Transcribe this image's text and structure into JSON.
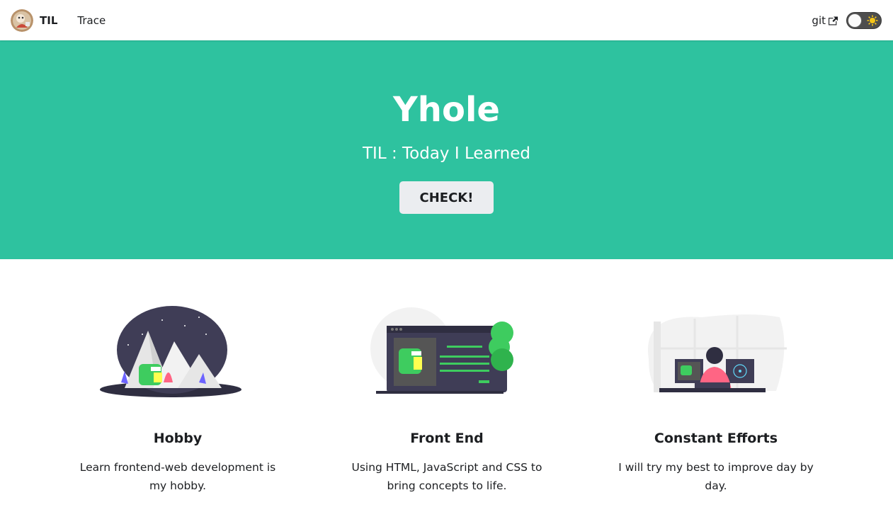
{
  "navbar": {
    "brand_title": "TIL",
    "links": [
      {
        "label": "Trace"
      }
    ],
    "git_label": "git",
    "theme_toggle": {
      "mode": "light",
      "icons": [
        "moon-icon",
        "sun-icon"
      ]
    }
  },
  "hero": {
    "title": "Yhole",
    "subtitle": "TIL : Today I Learned",
    "button_label": "CHECK!",
    "background": "#2ec29f"
  },
  "features": [
    {
      "title": "Hobby",
      "description": "Learn frontend-web development is my hobby.",
      "illustration": "mountain-dino-illustration"
    },
    {
      "title": "Front End",
      "description": "Using HTML, JavaScript and CSS to bring concepts to life.",
      "illustration": "browser-dino-illustration"
    },
    {
      "title": "Constant Efforts",
      "description": "I will try my best to improve day by day.",
      "illustration": "developer-desk-illustration"
    }
  ],
  "colors": {
    "accent": "#2ec29f",
    "dark_illustration": "#3f3d56",
    "dino_green": "#3ecc5f"
  }
}
